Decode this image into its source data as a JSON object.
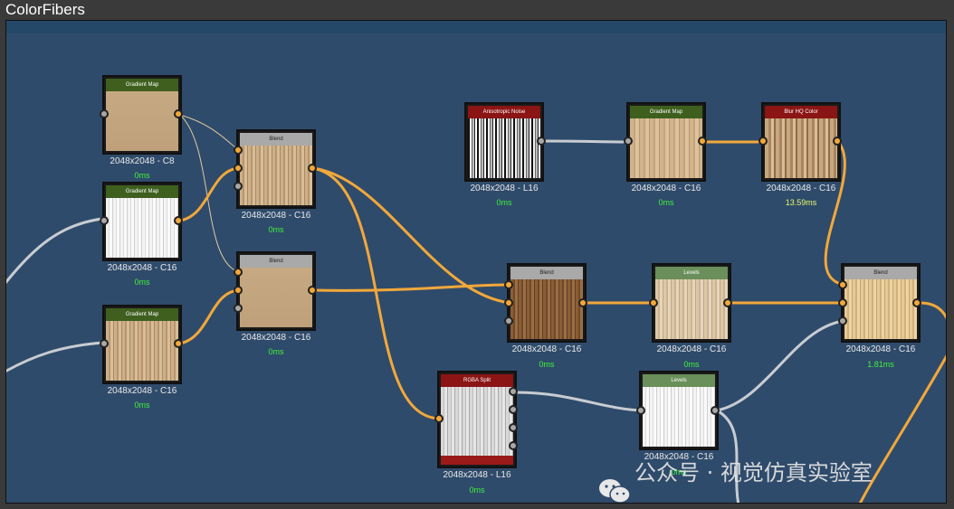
{
  "window": {
    "title": "ColorFibers"
  },
  "nodes": [
    {
      "name": "gradient-map-node-1",
      "title": "Gradient Map",
      "res": "2048x2048 - C8",
      "time": "0ms"
    },
    {
      "name": "gradient-map-node-2",
      "title": "Gradient Map",
      "res": "2048x2048 - C16",
      "time": "0ms"
    },
    {
      "name": "gradient-map-node-3",
      "title": "Gradient Map",
      "res": "2048x2048 - C16",
      "time": "0ms"
    },
    {
      "name": "blend-node-1",
      "title": "Blend",
      "res": "2048x2048 - C16",
      "time": "0ms"
    },
    {
      "name": "blend-node-2",
      "title": "Blend",
      "res": "2048x2048 - C16",
      "time": "0ms"
    },
    {
      "name": "anisotropic-noise-node",
      "title": "Anisotropic Noise",
      "res": "2048x2048 - L16",
      "time": "0ms"
    },
    {
      "name": "gradient-map-node-4",
      "title": "Gradient Map",
      "res": "2048x2048 - C16",
      "time": "0ms"
    },
    {
      "name": "blur-hq-color-node",
      "title": "Blur HQ Color",
      "res": "2048x2048 - C16",
      "time": "13.59ms"
    },
    {
      "name": "blend-node-3",
      "title": "Blend",
      "res": "2048x2048 - C16",
      "time": "0ms"
    },
    {
      "name": "levels-node-1",
      "title": "Levels",
      "res": "2048x2048 - C16",
      "time": "0ms"
    },
    {
      "name": "blend-node-4",
      "title": "Blend",
      "res": "2048x2048 - C16",
      "time": "1.81ms"
    },
    {
      "name": "rgba-split-node",
      "title": "RGBA Split",
      "res": "2048x2048 - L16",
      "time": "0ms"
    },
    {
      "name": "levels-node-2",
      "title": "Levels",
      "res": "2048x2048 - C16",
      "time": "0ms"
    }
  ],
  "watermark": {
    "text": "公众号 · 视觉仿真实验室"
  },
  "colors": {
    "canvas": "#2f4b6b",
    "wire_color": "#f2a83a",
    "wire_gray": "#c8ccd2",
    "time_green": "#3ff03a",
    "time_yellow": "#e6f56a"
  }
}
